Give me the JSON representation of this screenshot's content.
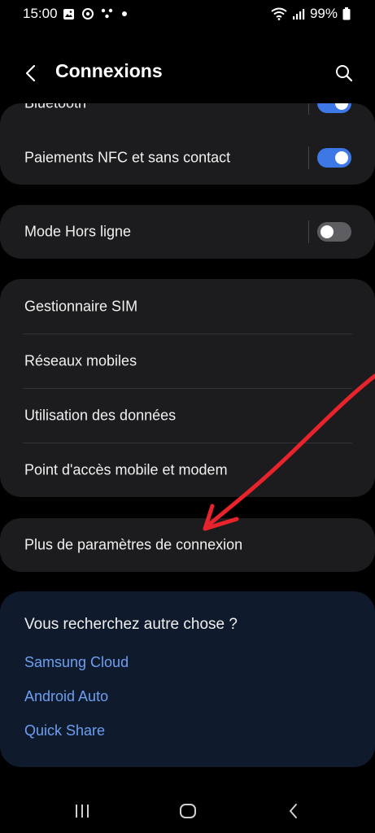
{
  "status_bar": {
    "time": "15:00",
    "battery": "99%",
    "left_icons": [
      "image-icon",
      "sync-icon",
      "dots-icon",
      "dot-icon"
    ],
    "right_icons": [
      "wifi-icon",
      "signal-icon",
      "battery-icon"
    ]
  },
  "header": {
    "title": "Connexions",
    "back_icon": "chevron-left-icon",
    "search_icon": "search-icon"
  },
  "settings": {
    "bluetooth": {
      "label": "Bluetooth",
      "toggle": "on"
    },
    "nfc": {
      "label": "Paiements NFC et sans contact",
      "toggle": "on"
    },
    "airplane": {
      "label": "Mode Hors ligne",
      "toggle": "off"
    },
    "sim_manager": {
      "label": "Gestionnaire SIM"
    },
    "mobile_networks": {
      "label": "Réseaux mobiles"
    },
    "data_usage": {
      "label": "Utilisation des données"
    },
    "hotspot": {
      "label": "Point d'accès mobile et modem"
    },
    "more_settings": {
      "label": "Plus de paramètres de connexion"
    }
  },
  "suggestions": {
    "title": "Vous recherchez autre chose ?",
    "links": [
      "Samsung Cloud",
      "Android Auto",
      "Quick Share"
    ]
  },
  "nav_bar": {
    "icons": [
      "recents-icon",
      "home-icon",
      "back-icon"
    ]
  },
  "colors": {
    "background": "#000000",
    "card": "#1c1c1e",
    "toggle_on": "#3e78e6",
    "toggle_off": "#5d5d62",
    "link": "#6d9ff0",
    "suggestion_card": "#0f1a2d",
    "annotation_arrow": "#e8232b"
  }
}
